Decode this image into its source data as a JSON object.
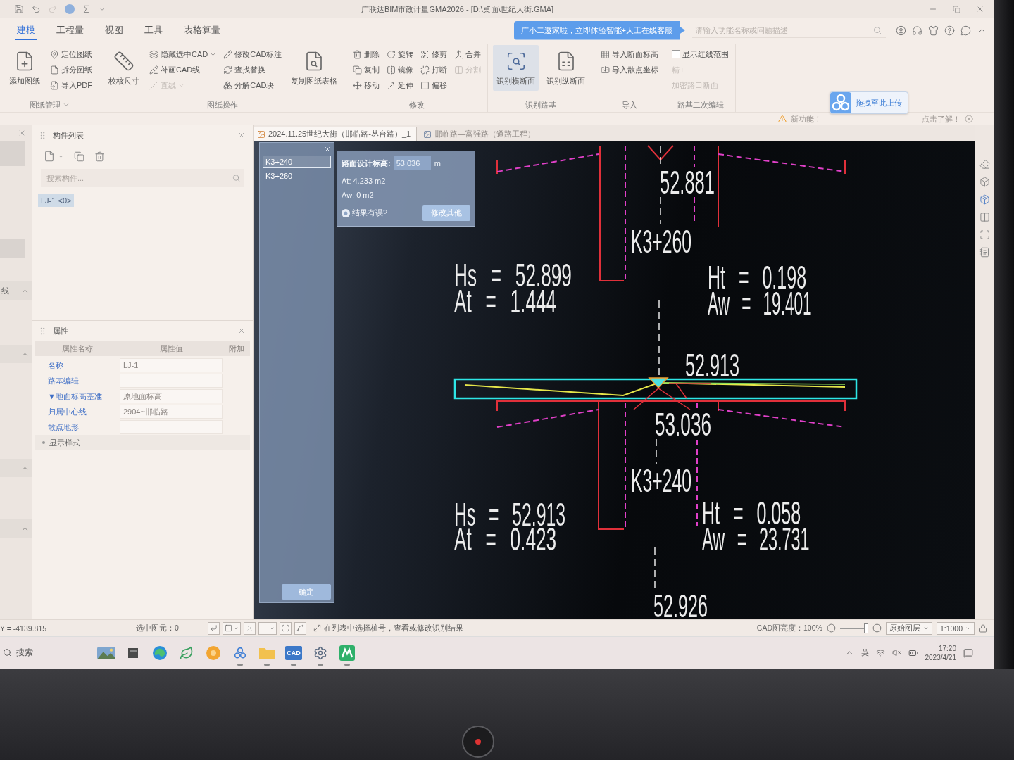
{
  "title_bar": {
    "title": "广联达BIM市政计量GMA2026 - [D:\\桌面\\世纪大街.GMA]"
  },
  "menu_tabs": [
    {
      "label": "建模",
      "selected": true
    },
    {
      "label": "工程量",
      "selected": false
    },
    {
      "label": "视图",
      "selected": false
    },
    {
      "label": "工具",
      "selected": false
    },
    {
      "label": "表格算量",
      "selected": false
    }
  ],
  "assistant_banner": {
    "text": "广小二邀家啦，立即体验智能+人工在线客服"
  },
  "search": {
    "placeholder": "请输入功能名称或问题描述"
  },
  "ribbon_groups": [
    {
      "title": "图纸管理",
      "menu": true,
      "items": [
        {
          "label": "添加图纸",
          "kind": "large",
          "selected": false,
          "disabled": false,
          "dropdown": false
        },
        {
          "label": "定位图纸",
          "kind": "small",
          "selected": false,
          "disabled": false,
          "dropdown": false
        },
        {
          "label": "拆分图纸",
          "kind": "small",
          "selected": false,
          "disabled": false,
          "dropdown": false
        },
        {
          "label": "导入PDF",
          "kind": "small",
          "selected": false,
          "disabled": false,
          "dropdown": false
        }
      ]
    },
    {
      "title": "图纸操作",
      "menu": false,
      "items": [
        {
          "label": "校核尺寸",
          "kind": "large",
          "selected": false,
          "disabled": false,
          "dropdown": false
        },
        {
          "label": "隐藏选中CAD",
          "kind": "small",
          "selected": false,
          "disabled": false,
          "dropdown": true
        },
        {
          "label": "补画CAD线",
          "kind": "small",
          "selected": false,
          "disabled": false,
          "dropdown": false
        },
        {
          "label": "直线",
          "kind": "small",
          "selected": false,
          "disabled": true,
          "dropdown": true
        },
        {
          "label": "修改CAD标注",
          "kind": "small",
          "selected": false,
          "disabled": false,
          "dropdown": false
        },
        {
          "label": "查找替换",
          "kind": "small",
          "selected": false,
          "disabled": false,
          "dropdown": false
        },
        {
          "label": "分解CAD块",
          "kind": "small",
          "selected": false,
          "disabled": false,
          "dropdown": false
        },
        {
          "label": "复制图纸表格",
          "kind": "large",
          "selected": false,
          "disabled": false,
          "dropdown": false
        }
      ]
    },
    {
      "title": "修改",
      "menu": false,
      "items": [
        {
          "label": "删除",
          "kind": "small",
          "selected": false,
          "disabled": false,
          "dropdown": false
        },
        {
          "label": "复制",
          "kind": "small",
          "selected": false,
          "disabled": false,
          "dropdown": false
        },
        {
          "label": "移动",
          "kind": "small",
          "selected": false,
          "disabled": false,
          "dropdown": false
        },
        {
          "label": "旋转",
          "kind": "small",
          "selected": false,
          "disabled": false,
          "dropdown": false
        },
        {
          "label": "镜像",
          "kind": "small",
          "selected": false,
          "disabled": false,
          "dropdown": false
        },
        {
          "label": "延伸",
          "kind": "small",
          "selected": false,
          "disabled": false,
          "dropdown": false
        },
        {
          "label": "修剪",
          "kind": "small",
          "selected": false,
          "disabled": false,
          "dropdown": false
        },
        {
          "label": "打断",
          "kind": "small",
          "selected": false,
          "disabled": false,
          "dropdown": false
        },
        {
          "label": "偏移",
          "kind": "small",
          "selected": false,
          "disabled": false,
          "dropdown": false
        },
        {
          "label": "合并",
          "kind": "small",
          "selected": false,
          "disabled": false,
          "dropdown": false
        },
        {
          "label": "分割",
          "kind": "small",
          "selected": false,
          "disabled": true,
          "dropdown": false
        }
      ]
    },
    {
      "title": "识别路基",
      "menu": false,
      "items": [
        {
          "label": "识别横断面",
          "kind": "large",
          "selected": true,
          "disabled": false,
          "dropdown": false
        },
        {
          "label": "识别纵断面",
          "kind": "large",
          "selected": false,
          "disabled": false,
          "dropdown": false
        }
      ]
    },
    {
      "title": "导入",
      "menu": false,
      "items": [
        {
          "label": "导入断面标高",
          "kind": "small",
          "selected": false,
          "disabled": false,
          "dropdown": false
        },
        {
          "label": "导入散点坐标",
          "kind": "small",
          "selected": false,
          "disabled": false,
          "dropdown": false
        }
      ]
    },
    {
      "title": "路基二次编辑",
      "menu": false,
      "items": [
        {
          "label": "显示红线范围",
          "kind": "checkbox",
          "checked": false,
          "selected": false,
          "disabled": false,
          "dropdown": false
        },
        {
          "label": "精+",
          "kind": "small",
          "selected": false,
          "disabled": true,
          "dropdown": false
        },
        {
          "label": "加密路口断面",
          "kind": "small",
          "selected": false,
          "disabled": true,
          "dropdown": false
        }
      ]
    }
  ],
  "upload_widget": {
    "text": "拖拽至此上传"
  },
  "notification": {
    "text": "新功能！",
    "link": "点击了解！"
  },
  "left_strip": {
    "sections": [
      {
        "label": "线",
        "expanded": true
      },
      {
        "expanded": true
      },
      {
        "expanded": true
      },
      {
        "expanded": true
      }
    ]
  },
  "component_list": {
    "title": "构件列表",
    "search_placeholder": "搜索构件...",
    "items": [
      {
        "label": "LJ-1 <0>",
        "selected": true
      }
    ]
  },
  "properties": {
    "title": "属性",
    "columns": [
      "属性名称",
      "属性值",
      "附加"
    ],
    "rows": [
      {
        "kind": "field",
        "name": "名称",
        "value": "LJ-1"
      },
      {
        "kind": "field",
        "name": "路基编辑"
      },
      {
        "kind": "field",
        "name": "▼地面标高基准",
        "value": "原地面标高"
      },
      {
        "kind": "field",
        "name": "归属中心线",
        "value": "2904~邯临路"
      },
      {
        "kind": "field",
        "name": "散点地形"
      },
      {
        "kind": "group",
        "name": "显示样式"
      }
    ]
  },
  "canvas_tabs": [
    {
      "label": "2024.11.25世纪大街（邯临路-丛台路）_1",
      "selected": true
    },
    {
      "label": "邯临路—富强路（道路工程）",
      "selected": false
    }
  ],
  "station_list": {
    "items": [
      {
        "label": "K3+240",
        "selected": true
      },
      {
        "label": "K3+260",
        "selected": false
      }
    ],
    "button": "确定"
  },
  "result_popup": {
    "label": "路面设计标高:",
    "value": "53.036",
    "unit": "m",
    "lines": [
      "At: 4.233 m2",
      "Aw: 0 m2"
    ],
    "help": "结果有误?",
    "button": "修改其他"
  },
  "cad_labels": [
    "52.881",
    "K3+260",
    "Hs = 52.899",
    "At = 1.444",
    "Ht = 0.198",
    "Aw = 19.401",
    "52.913",
    "53.036",
    "K3+240",
    "Hs = 52.913",
    "At = 0.423",
    "Ht = 0.058",
    "Aw = 23.731",
    "52.926"
  ],
  "status_bar": {
    "coordinate": "Y = -4139.815",
    "selection": "选中图元：0",
    "hint": "在列表中选择桩号，查看或修改识别结果",
    "brightness_label": "CAD图亮度：100%",
    "brightness": {
      "level": 1
    },
    "layer": "原始图层",
    "scale": "1:1000"
  },
  "taskbar": {
    "search": "搜索",
    "apps": [
      {
        "running": false
      },
      {
        "running": false
      },
      {
        "running": false
      },
      {
        "running": false
      },
      {
        "running": false
      },
      {
        "running": true
      },
      {
        "running": true
      },
      {
        "label": "CAD",
        "running": true
      },
      {
        "running": true
      },
      {
        "running": true
      }
    ],
    "ime": "英",
    "time": "17:20",
    "date": "2023/4/21"
  }
}
